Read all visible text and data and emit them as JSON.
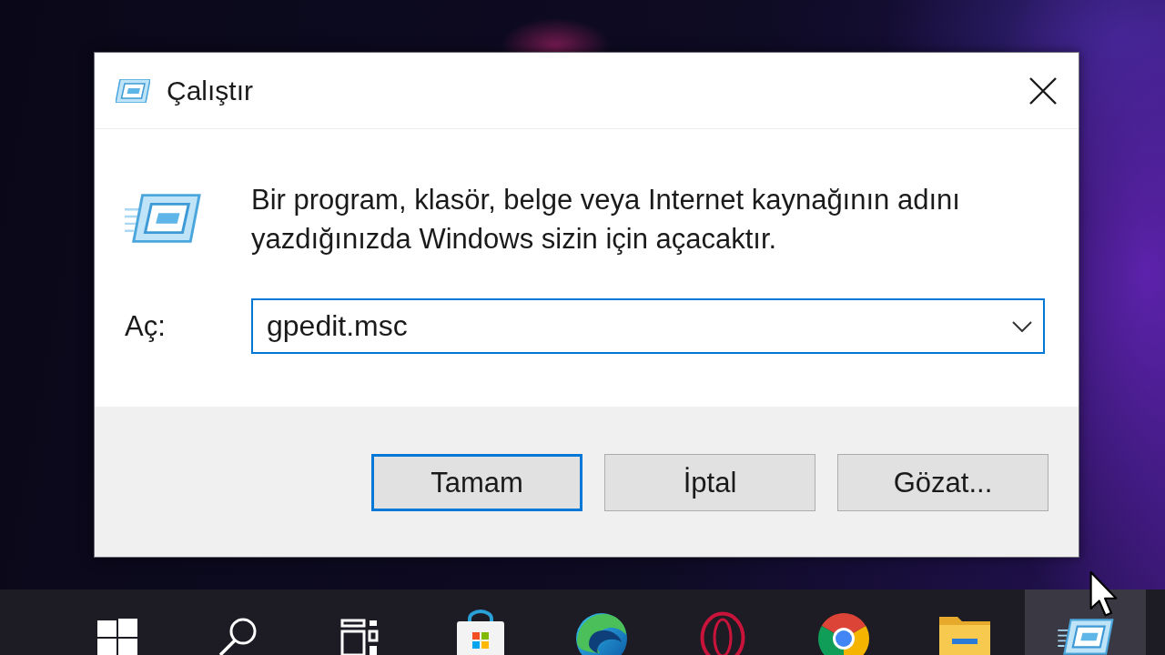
{
  "window": {
    "title": "Çalıştır"
  },
  "dialog": {
    "description": "Bir program, klasör, belge veya Internet kaynağının adını yazdığınızda Windows sizin için açacaktır.",
    "open_label": "Aç:",
    "open_field": {
      "value": "gpedit.msc",
      "focused": true
    },
    "buttons": [
      {
        "label": "Tamam",
        "default": true
      },
      {
        "label": "İptal",
        "default": false
      },
      {
        "label": "Gözat...",
        "default": false
      }
    ]
  },
  "taskbar": {
    "items": [
      {
        "kind": "start",
        "active": false
      },
      {
        "kind": "search",
        "active": false
      },
      {
        "kind": "task_view",
        "active": false
      },
      {
        "kind": "store",
        "active": false
      },
      {
        "kind": "edge",
        "active": false
      },
      {
        "kind": "opera",
        "active": false
      },
      {
        "kind": "chrome",
        "active": false
      },
      {
        "kind": "folder",
        "active": false
      },
      {
        "kind": "run",
        "active": true
      }
    ]
  }
}
